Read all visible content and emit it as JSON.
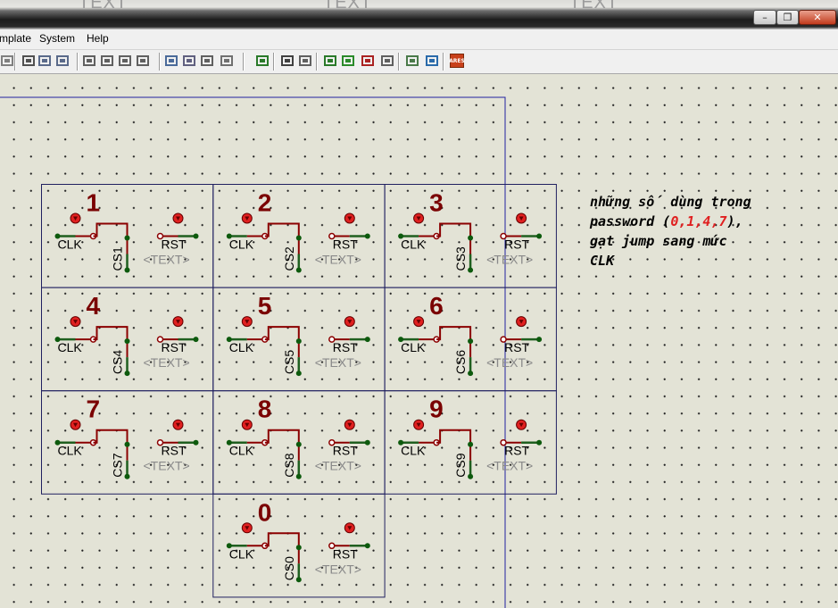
{
  "titlebar": {
    "ghost_text": "TEXT"
  },
  "window_controls": {
    "minimize": "–",
    "restore": "❐",
    "close": "✕"
  },
  "menu": {
    "items": [
      "mplate",
      "System",
      "Help"
    ]
  },
  "toolbar": {
    "icons": [
      "redo-icon",
      "cut-icon",
      "copy-icon",
      "paste-icon",
      "block-copy-icon",
      "block-move-icon",
      "block-rotate-icon",
      "block-delete-icon",
      "pick-device-icon",
      "make-device-icon",
      "packaging-tool-icon",
      "decompose-icon",
      "wire-autorouter-icon",
      "search-icon",
      "property-assignment-icon",
      "new-sheet-icon",
      "add-sheet-icon",
      "remove-sheet-icon",
      "goto-sheet-icon",
      "bill-of-materials-icon",
      "electrical-rule-check-icon",
      "ares-icon"
    ],
    "ares_label": "ARES"
  },
  "schematic": {
    "cells": [
      {
        "number": "1",
        "cs": "CS1"
      },
      {
        "number": "2",
        "cs": "CS2"
      },
      {
        "number": "3",
        "cs": "CS3"
      },
      {
        "number": "4",
        "cs": "CS4"
      },
      {
        "number": "5",
        "cs": "CS5"
      },
      {
        "number": "6",
        "cs": "CS6"
      },
      {
        "number": "7",
        "cs": "CS7"
      },
      {
        "number": "8",
        "cs": "CS8"
      },
      {
        "number": "9",
        "cs": "CS9"
      },
      {
        "number": "0",
        "cs": "CS0"
      }
    ],
    "clk_label": "CLK",
    "rst_label": "RST",
    "text_placeholder": "<TEXT>"
  },
  "note": {
    "line1": "những số dùng trong",
    "line2_prefix": "password (",
    "line2_red": "0,1,4,7",
    "line2_suffix": "),",
    "line3": "gạt jump sang mức",
    "line4": "CLK"
  },
  "colors": {
    "wire": "#8b0000",
    "pin_green": "#1f5f1f",
    "node": "#0d5a0d",
    "probe": "#e02020",
    "frame": "#202060",
    "sheet_border": "#2020a0",
    "label_gray": "#8a8a8a"
  }
}
